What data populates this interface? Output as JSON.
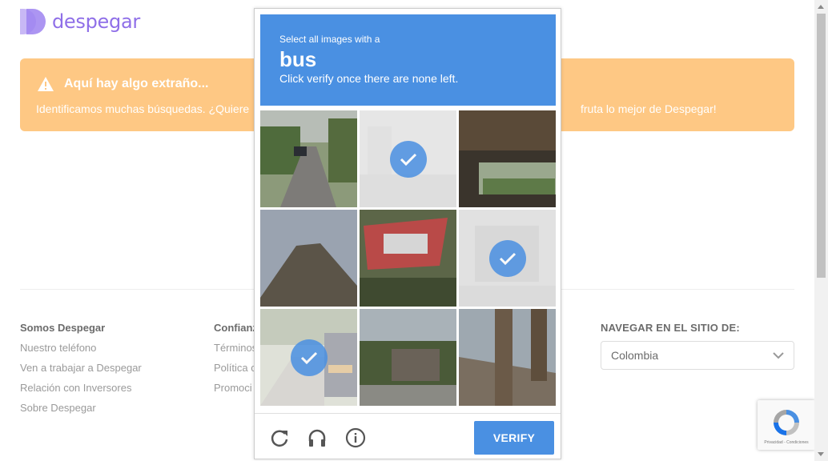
{
  "header": {
    "brand": "despegar"
  },
  "banner": {
    "title": "Aquí hay algo extraño...",
    "text_left": "Identificamos muchas búsquedas. ¿Quiere",
    "text_right": "fruta lo mejor de Despegar!"
  },
  "footer": {
    "col1": {
      "heading": "Somos Despegar",
      "links": [
        "Nuestro teléfono",
        "Ven a trabajar a Despegar",
        "Relación con Inversores",
        "Sobre Despegar"
      ]
    },
    "col2": {
      "heading": "Confianz",
      "links": [
        "Términos",
        "Política c",
        "Promoci"
      ]
    },
    "nav_site": {
      "heading": "NAVEGAR EN EL SITIO DE:",
      "selected": "Colombia"
    }
  },
  "captcha": {
    "instruction_pre": "Select all images with a",
    "target_word": "bus",
    "instruction_post": "Click verify once there are none left.",
    "tiles": [
      {
        "scene": "road-with-car",
        "selected": false
      },
      {
        "scene": "faded-street",
        "selected": true
      },
      {
        "scene": "bridge-underside",
        "selected": false
      },
      {
        "scene": "hill-trees",
        "selected": false
      },
      {
        "scene": "billboard-car",
        "selected": false
      },
      {
        "scene": "faded-building",
        "selected": true
      },
      {
        "scene": "street-bus",
        "selected": true
      },
      {
        "scene": "building-trees",
        "selected": false
      },
      {
        "scene": "overpass-sun",
        "selected": false
      }
    ],
    "verify_label": "VERIFY"
  },
  "recaptcha_badge": {
    "text": "Privacidad - Condiciones"
  },
  "colors": {
    "brand": "#8f6fe8",
    "banner": "#fec884",
    "captcha_blue": "#4a90e2"
  }
}
